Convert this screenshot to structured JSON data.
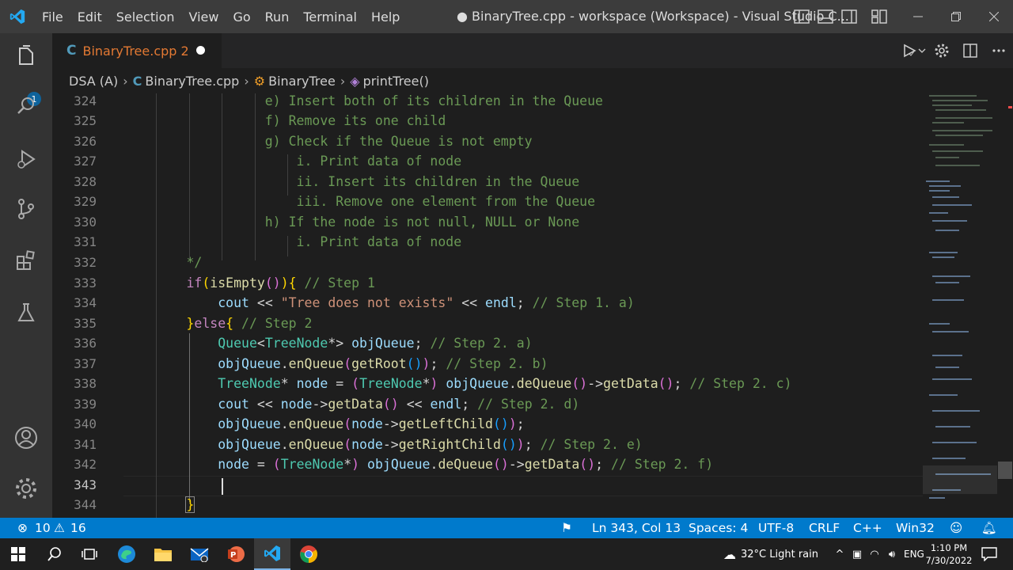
{
  "app": {
    "title": "● BinaryTree.cpp - workspace (Workspace) - Visual Studio C...",
    "menu": [
      "File",
      "Edit",
      "Selection",
      "View",
      "Go",
      "Run",
      "Terminal",
      "Help"
    ]
  },
  "activity": {
    "badge": "1"
  },
  "tab": {
    "name": "BinaryTree.cpp 2"
  },
  "breadcrumb": {
    "items": [
      "DSA (A)",
      "BinaryTree.cpp",
      "BinaryTree",
      "printTree()"
    ]
  },
  "editor": {
    "line_numbers": [
      "324",
      "325",
      "326",
      "327",
      "328",
      "329",
      "330",
      "331",
      "332",
      "333",
      "334",
      "335",
      "336",
      "337",
      "338",
      "339",
      "340",
      "341",
      "342",
      "343",
      "344"
    ],
    "current_line": "343"
  },
  "status": {
    "errors": "10",
    "warnings": "16",
    "position": "Ln 343, Col 13",
    "spaces": "Spaces: 4",
    "encoding": "UTF-8",
    "eol": "CRLF",
    "language": "C++",
    "platform": "Win32"
  },
  "taskbar": {
    "weather": "32°C  Light rain",
    "lang": "ENG",
    "time": "1:10 PM",
    "date": "7/30/2022"
  },
  "colors": {
    "accent": "#007acc",
    "background": "#1e1e1e",
    "tab_modified": "#e37933"
  },
  "icons": [
    "vscode-logo",
    "explorer-icon",
    "search-icon",
    "run-debug-icon",
    "source-control-icon",
    "extensions-icon",
    "testing-icon",
    "account-icon",
    "manage-gear-icon",
    "windows-start-icon",
    "taskbar-search-icon",
    "task-view-icon",
    "edge-icon",
    "file-explorer-icon",
    "mail-icon",
    "powerpoint-icon",
    "vscode-icon",
    "chrome-icon"
  ]
}
